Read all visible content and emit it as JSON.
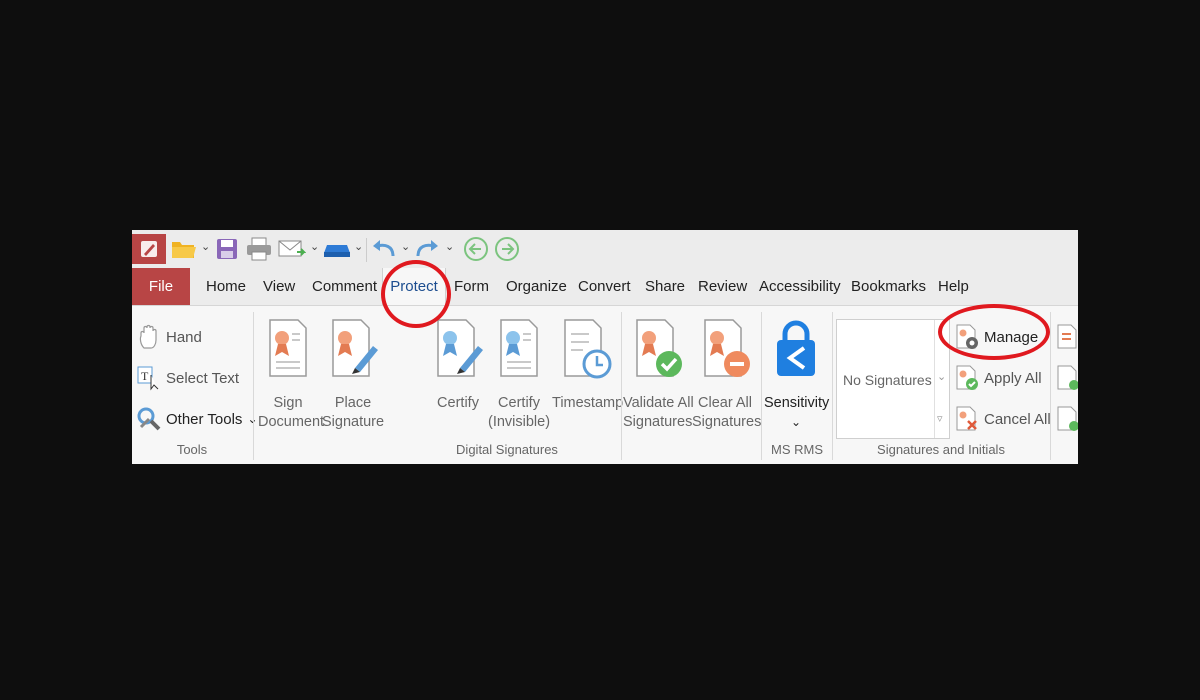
{
  "quick_access": {
    "icons": [
      "app-logo-icon",
      "open-folder-icon",
      "save-icon",
      "print-icon",
      "email-icon",
      "scanner-icon",
      "undo-icon",
      "redo-icon",
      "back-icon",
      "forward-icon"
    ]
  },
  "tabs": [
    {
      "label": "File"
    },
    {
      "label": "Home"
    },
    {
      "label": "View"
    },
    {
      "label": "Comment"
    },
    {
      "label": "Protect"
    },
    {
      "label": "Form"
    },
    {
      "label": "Organize"
    },
    {
      "label": "Convert"
    },
    {
      "label": "Share"
    },
    {
      "label": "Review"
    },
    {
      "label": "Accessibility"
    },
    {
      "label": "Bookmarks"
    },
    {
      "label": "Help"
    }
  ],
  "active_tab": "Protect",
  "ribbon": {
    "tools": {
      "label": "Tools",
      "hand": "Hand",
      "select_text": "Select Text",
      "other_tools": "Other Tools"
    },
    "digital_signatures": {
      "label": "Digital Signatures",
      "sign_document": [
        "Sign",
        "Document"
      ],
      "place_signature": [
        "Place",
        "Signature"
      ],
      "certify": [
        "Certify"
      ],
      "certify_invisible": [
        "Certify",
        "(Invisible)"
      ],
      "timestamp": [
        "Timestamp"
      ],
      "validate_all": [
        "Validate All",
        "Signatures"
      ],
      "clear_all": [
        "Clear All",
        "Signatures"
      ]
    },
    "ms_rms": {
      "label": "MS RMS",
      "sensitivity": "Sensitivity"
    },
    "signatures_and_initials": {
      "label": "Signatures and Initials",
      "gallery_text": "No Signatures",
      "manage": "Manage",
      "apply_all": "Apply All",
      "cancel_all": "Cancel All"
    }
  },
  "colors": {
    "file_tab": "#b84545",
    "active_tab_text": "#1c4d8f",
    "highlight_ring": "#e0191f",
    "page_background": "#0e0e0e"
  }
}
